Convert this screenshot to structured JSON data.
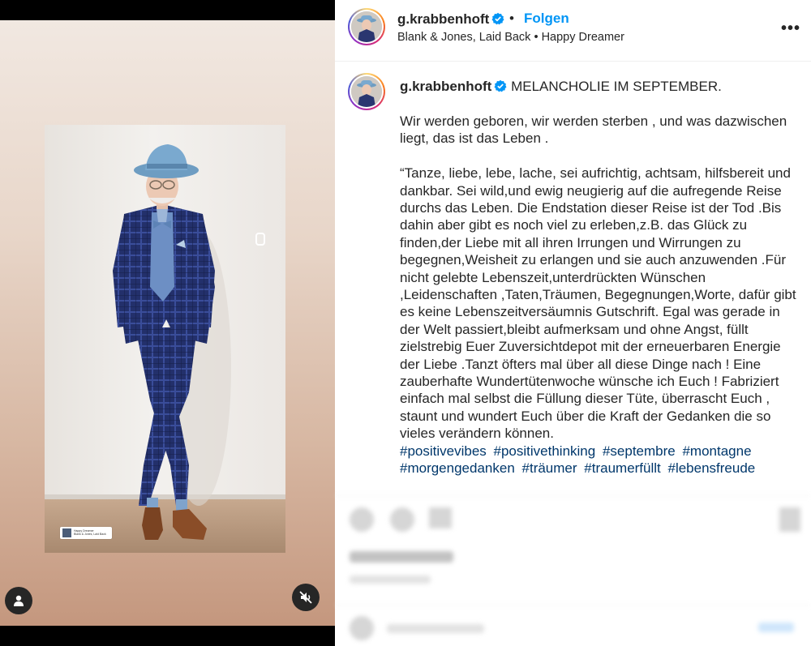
{
  "media": {
    "track_title": "Happy Dreamer",
    "track_artist": "Blank & Jones, Laid Back",
    "user_icon": "user-icon",
    "mute_icon": "speaker-muted-icon",
    "tag_icon": "tag-icon"
  },
  "header": {
    "username": "g.krabbenhoft",
    "verified_icon": "verified-badge-icon",
    "separator": "•",
    "follow_label": "Folgen",
    "audio_artist": "Blank & Jones, Laid Back",
    "audio_separator": "•",
    "audio_title": "Happy Dreamer",
    "more_label": "•••"
  },
  "caption": {
    "username": "g.krabbenhoft",
    "title": "MELANCHOLIE IM SEPTEMBER.",
    "paragraph1": "Wir werden geboren, wir werden sterben , und was dazwischen liegt, das ist das Leben .",
    "paragraph2": "“Tanze, liebe, lebe, lache, sei aufrichtig, achtsam, hilfsbereit und dankbar. Sei wild,und ewig neugierig auf die aufregende Reise durchs das Leben. Die Endstation dieser Reise ist der Tod .Bis dahin aber gibt es noch viel zu erleben,z.B. das Glück zu finden,der Liebe mit all ihren Irrungen und Wirrungen zu begegnen,Weisheit zu erlangen und sie auch anzuwenden .Für nicht gelebte Lebenszeit,unterdrückten Wünschen ,Leidenschaften ,Taten,Träumen, Begegnungen,Worte, dafür gibt es keine Lebenszeitversäumnis Gutschrift. Egal was gerade in der Welt passiert,bleibt aufmerksam und ohne Angst, füllt zielstrebig Euer Zuversichtdepot mit der erneuerbaren Energie der Liebe .Tanzt öfters mal über all diese Dinge nach ! Eine zauberhafte Wundertütenwoche wünsche ich Euch ! Fabriziert einfach mal selbst die Füllung dieser Tüte, überrascht Euch , staunt und wundert Euch über die Kraft der Gedanken die so vieles verändern können.",
    "hashtags": [
      "#positivevibes",
      "#positivethinking",
      "#septembre",
      "#montagne",
      "#morgengedanken",
      "#träumer",
      "#traumerfüllt",
      "#lebensfreude"
    ]
  },
  "colors": {
    "accent_blue": "#0095f6",
    "hashtag_blue": "#00376b",
    "text": "#262626"
  }
}
